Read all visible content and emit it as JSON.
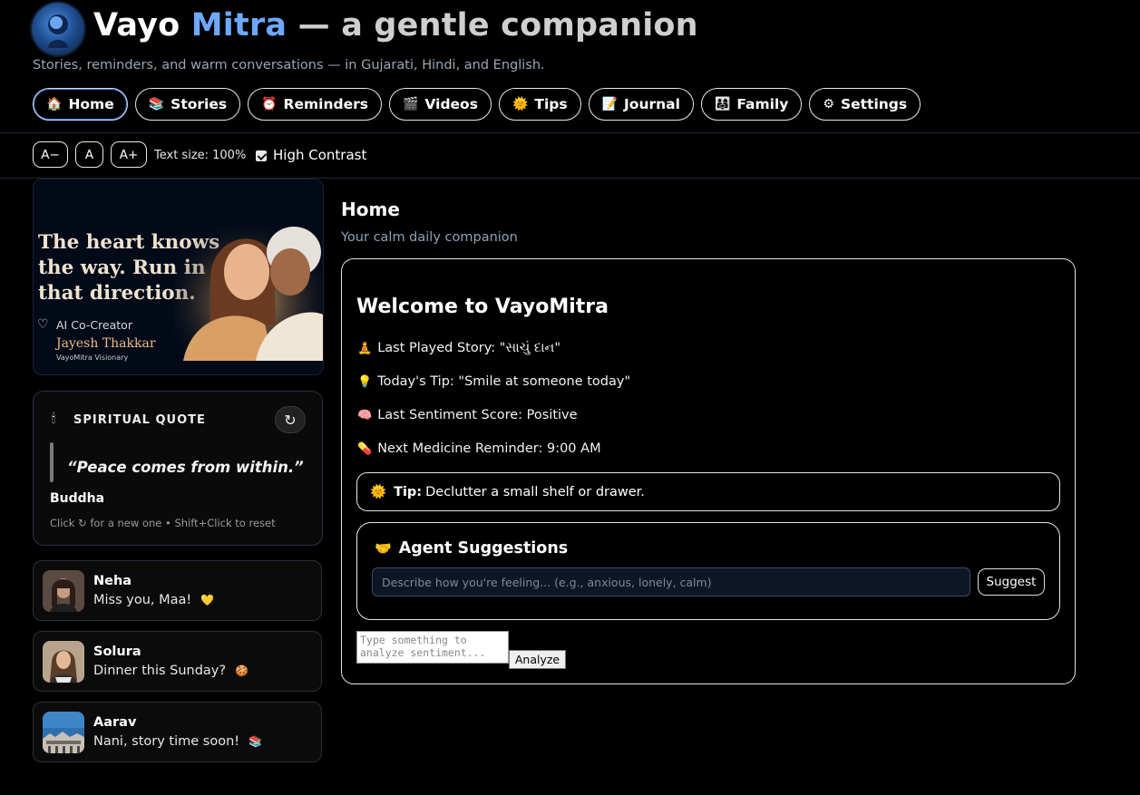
{
  "header": {
    "title_part1": "Vayo",
    "title_part2": "Mitra",
    "title_part3": "— a gentle companion",
    "subtitle": "Stories, reminders, and warm conversations — in Gujarati, Hindi, and English."
  },
  "nav": {
    "items": [
      {
        "icon": "🏠",
        "label": "Home"
      },
      {
        "icon": "📚",
        "label": "Stories"
      },
      {
        "icon": "⏰",
        "label": "Reminders"
      },
      {
        "icon": "🎬",
        "label": "Videos"
      },
      {
        "icon": "🌞",
        "label": "Tips"
      },
      {
        "icon": "📝",
        "label": "Journal"
      },
      {
        "icon": "👨‍👩‍👧",
        "label": "Family"
      },
      {
        "icon": "⚙",
        "label": "Settings"
      }
    ],
    "active": "Home"
  },
  "toolbar": {
    "decrease_label": "A−",
    "reset_label": "A",
    "increase_label": "A+",
    "text_size": "Text size: 100%",
    "high_contrast_label": "High Contrast",
    "high_contrast_checked": true
  },
  "banner": {
    "quote": "The heart knows\nthe way. Run in\nthat direction.",
    "co_creator_label": "AI Co-Creator",
    "name": "Jayesh Thakkar",
    "tagline": "VayoMitra Visionary"
  },
  "spiritual_quote": {
    "heading": "SPIRITUAL QUOTE",
    "candle_icon": "🕯",
    "refresh_icon": "↻",
    "text": "“Peace comes from within.”",
    "author": "Buddha",
    "hint": "Click ↻ for a new one • Shift+Click to reset"
  },
  "messages": [
    {
      "name": "Neha",
      "text": "Miss you, Maa!",
      "emoji": "💛"
    },
    {
      "name": "Solura",
      "text": "Dinner this Sunday?",
      "emoji": "🍪"
    },
    {
      "name": "Aarav",
      "text": "Nani, story time soon!",
      "emoji": "📚"
    }
  ],
  "main": {
    "title": "Home",
    "subtitle": "Your calm daily companion",
    "welcome": "Welcome to VayoMitra",
    "stats": [
      {
        "icon": "🧘",
        "text": "Last Played Story: \"સાચું દાન\""
      },
      {
        "icon": "💡",
        "text": "Today's Tip: \"Smile at someone today\""
      },
      {
        "icon": "🧠",
        "text": "Last Sentiment Score: Positive"
      },
      {
        "icon": "💊",
        "text": "Next Medicine Reminder: 9:00 AM"
      }
    ],
    "tip": {
      "icon": "🌞",
      "label": "Tip:",
      "text": "Declutter a small shelf or drawer."
    },
    "agent": {
      "icon": "🤝",
      "title": "Agent Suggestions",
      "placeholder": "Describe how you're feeling... (e.g., anxious, lonely, calm)",
      "button": "Suggest"
    },
    "sentiment": {
      "placeholder": "Type something to analyze sentiment...",
      "button": "Analyze"
    }
  },
  "colors": {
    "background": "#000000",
    "accent": "#6ea8ff",
    "muted_text": "#8fa1b8"
  }
}
